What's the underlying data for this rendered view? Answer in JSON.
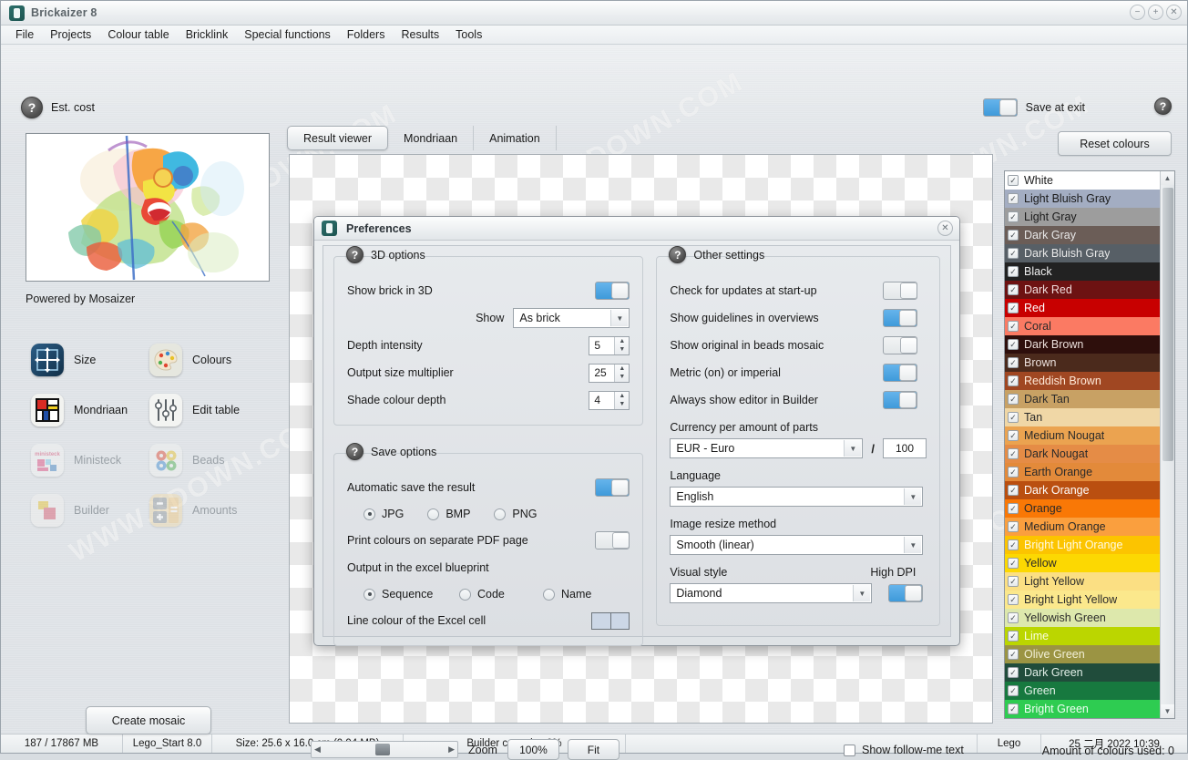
{
  "window": {
    "title": "Brickaizer 8",
    "controls": {
      "minimize": "−",
      "maximize": "+",
      "close": "✕"
    }
  },
  "menubar": {
    "items": [
      "File",
      "Projects",
      "Colour table",
      "Bricklink",
      "Special functions",
      "Folders",
      "Results",
      "Tools"
    ]
  },
  "toolbar": {
    "est_cost_label": "Est. cost",
    "save_at_exit_label": "Save at exit",
    "save_at_exit_on": true,
    "reset_colours_label": "Reset colours",
    "help_icon": "question-mark-icon"
  },
  "left_panel": {
    "powered_by": "Powered by Mosaizer",
    "create_mosaic_label": "Create mosaic",
    "tools": [
      {
        "label": "Size",
        "icon": "size-icon",
        "enabled": true
      },
      {
        "label": "Colours",
        "icon": "palette-icon",
        "enabled": true
      },
      {
        "label": "Mondriaan",
        "icon": "mondriaan-icon",
        "enabled": true
      },
      {
        "label": "Edit table",
        "icon": "sliders-icon",
        "enabled": true
      },
      {
        "label": "Ministeck",
        "icon": "ministeck-icon",
        "enabled": false
      },
      {
        "label": "Beads",
        "icon": "beads-icon",
        "enabled": false
      },
      {
        "label": "Builder",
        "icon": "builder-icon",
        "enabled": false
      },
      {
        "label": "Amounts",
        "icon": "calculator-icon",
        "enabled": false
      }
    ]
  },
  "tabs": {
    "items": [
      "Result viewer",
      "Mondriaan",
      "Animation"
    ],
    "active": "Result viewer"
  },
  "zoombar": {
    "zoom_label": "Zoom",
    "zoom_value": "100%",
    "fit_label": "Fit",
    "follow_me_label": "Show follow-me text",
    "follow_me_checked": false,
    "amount_of_colours_used": "Amount of colours used: 0",
    "scroll_left_icon": "triangle-left-icon",
    "scroll_right_icon": "triangle-right-icon"
  },
  "statusbar": {
    "memory": "187 / 17867 MB",
    "project": "Lego_Start 8.0",
    "size": "Size: 25.6 x 16.0 cm (0.94 MB)",
    "builder_capacity": "Builder capacity: 0%",
    "mode": "Lego",
    "datetime": "25 二月 2022  10:39"
  },
  "dialog": {
    "title": "Preferences",
    "close_icon": "close-icon",
    "groups": {
      "three_d": {
        "title": "3D options",
        "show_brick_in_3d": {
          "label": "Show brick in 3D",
          "on": true
        },
        "show": {
          "label": "Show",
          "value": "As brick"
        },
        "depth_intensity": {
          "label": "Depth intensity",
          "value": "5"
        },
        "output_size_multiplier": {
          "label": "Output size multiplier",
          "value": "25"
        },
        "shade_colour_depth": {
          "label": "Shade colour depth",
          "value": "4"
        }
      },
      "save": {
        "title": "Save options",
        "automatic_save": {
          "label": "Automatic save  the result",
          "on": true
        },
        "format_options": [
          "JPG",
          "BMP",
          "PNG"
        ],
        "format_selected": "JPG",
        "print_colours_pdf": {
          "label": "Print colours on separate PDF page",
          "on": false
        },
        "excel_blueprint_label": "Output in the excel blueprint",
        "excel_options": [
          "Sequence",
          "Code",
          "Name"
        ],
        "excel_selected": "Sequence",
        "line_colour_label": "Line colour of the Excel cell",
        "line_colour_value": "#ccd7e6"
      },
      "other": {
        "title": "Other settings",
        "toggles": [
          {
            "label": "Check for updates at start-up",
            "on": false
          },
          {
            "label": "Show guidelines in overviews",
            "on": true
          },
          {
            "label": "Show original in beads mosaic",
            "on": false
          },
          {
            "label": "Metric (on) or imperial",
            "on": true
          },
          {
            "label": "Always show editor in Builder",
            "on": true
          }
        ],
        "currency_label": "Currency per amount of parts",
        "currency_value": "EUR - Euro",
        "currency_separator": "/",
        "currency_amount": "100",
        "language_label": "Language",
        "language_value": "English",
        "resize_label": "Image resize method",
        "resize_value": "Smooth (linear)",
        "visual_style_label": "Visual style",
        "visual_style_value": "Diamond",
        "high_dpi_label": "High DPI",
        "high_dpi_on": true
      }
    }
  },
  "colour_list": {
    "scroll_up_icon": "triangle-up-icon",
    "scroll_down_icon": "triangle-down-icon",
    "check_icon": "check-icon",
    "items": [
      {
        "name": "White",
        "bg": "#ffffff",
        "fg": "#1a1a1a",
        "checked": true
      },
      {
        "name": "Light Bluish Gray",
        "bg": "#a3adc2",
        "fg": "#1a1a1a",
        "checked": true
      },
      {
        "name": "Light Gray",
        "bg": "#9d9d9d",
        "fg": "#1a1a1a",
        "checked": true
      },
      {
        "name": "Dark Gray",
        "bg": "#6b5d57",
        "fg": "#e8e8e8",
        "checked": true
      },
      {
        "name": "Dark Bluish Gray",
        "bg": "#575f66",
        "fg": "#e8e8e8",
        "checked": true
      },
      {
        "name": "Black",
        "bg": "#222222",
        "fg": "#f0f0f0",
        "checked": true
      },
      {
        "name": "Dark Red",
        "bg": "#6d1212",
        "fg": "#f0dede",
        "checked": true
      },
      {
        "name": "Red",
        "bg": "#c80000",
        "fg": "#ffffff",
        "checked": true
      },
      {
        "name": "Coral",
        "bg": "#fb7a63",
        "fg": "#2a2a2a",
        "checked": true
      },
      {
        "name": "Dark Brown",
        "bg": "#2e0f0c",
        "fg": "#ece0dc",
        "checked": true
      },
      {
        "name": "Brown",
        "bg": "#4b2a1c",
        "fg": "#ece0dc",
        "checked": true
      },
      {
        "name": "Reddish Brown",
        "bg": "#a04722",
        "fg": "#ffe9d8",
        "checked": true
      },
      {
        "name": "Dark Tan",
        "bg": "#c8a164",
        "fg": "#2a2a2a",
        "checked": true
      },
      {
        "name": "Tan",
        "bg": "#f0d7a6",
        "fg": "#2a2a2a",
        "checked": true
      },
      {
        "name": "Medium Nougat",
        "bg": "#eba350",
        "fg": "#2a2a2a",
        "checked": true
      },
      {
        "name": "Dark Nougat",
        "bg": "#e58c46",
        "fg": "#2a2a2a",
        "checked": true
      },
      {
        "name": "Earth Orange",
        "bg": "#e38a3a",
        "fg": "#2a2a2a",
        "checked": true
      },
      {
        "name": "Dark Orange",
        "bg": "#ba4f10",
        "fg": "#ffffff",
        "checked": true
      },
      {
        "name": "Orange",
        "bg": "#f97806",
        "fg": "#2a2a2a",
        "checked": true
      },
      {
        "name": "Medium Orange",
        "bg": "#fa9f3e",
        "fg": "#2a2a2a",
        "checked": true
      },
      {
        "name": "Bright Light Orange",
        "bg": "#fcc400",
        "fg": "#fffbe6",
        "checked": true
      },
      {
        "name": "Yellow",
        "bg": "#fcd802",
        "fg": "#2a2a2a",
        "checked": true
      },
      {
        "name": "Light Yellow",
        "bg": "#fbdf83",
        "fg": "#2a2a2a",
        "checked": true
      },
      {
        "name": "Bright Light Yellow",
        "bg": "#fbe88c",
        "fg": "#2a2a2a",
        "checked": true
      },
      {
        "name": "Yellowish Green",
        "bg": "#dde8ac",
        "fg": "#2a2a2a",
        "checked": true
      },
      {
        "name": "Lime",
        "bg": "#bbd600",
        "fg": "#fbfee0",
        "checked": true
      },
      {
        "name": "Olive Green",
        "bg": "#9b9443",
        "fg": "#f2f0d8",
        "checked": true
      },
      {
        "name": "Dark Green",
        "bg": "#204c3b",
        "fg": "#e2efe8",
        "checked": true
      },
      {
        "name": "Green",
        "bg": "#17793f",
        "fg": "#e2efe8",
        "checked": true
      },
      {
        "name": "Bright Green",
        "bg": "#2ecc51",
        "fg": "#f0fff4",
        "checked": true
      }
    ]
  },
  "watermarks": [
    "WWW.XDOWN.COM",
    "WWW.XDOWN.COM",
    "WWW.XDOWN.COM",
    "WWW.XDOWN.COM",
    "WWW.XDOWN.COM",
    "WWW.XDOWN.COM"
  ]
}
